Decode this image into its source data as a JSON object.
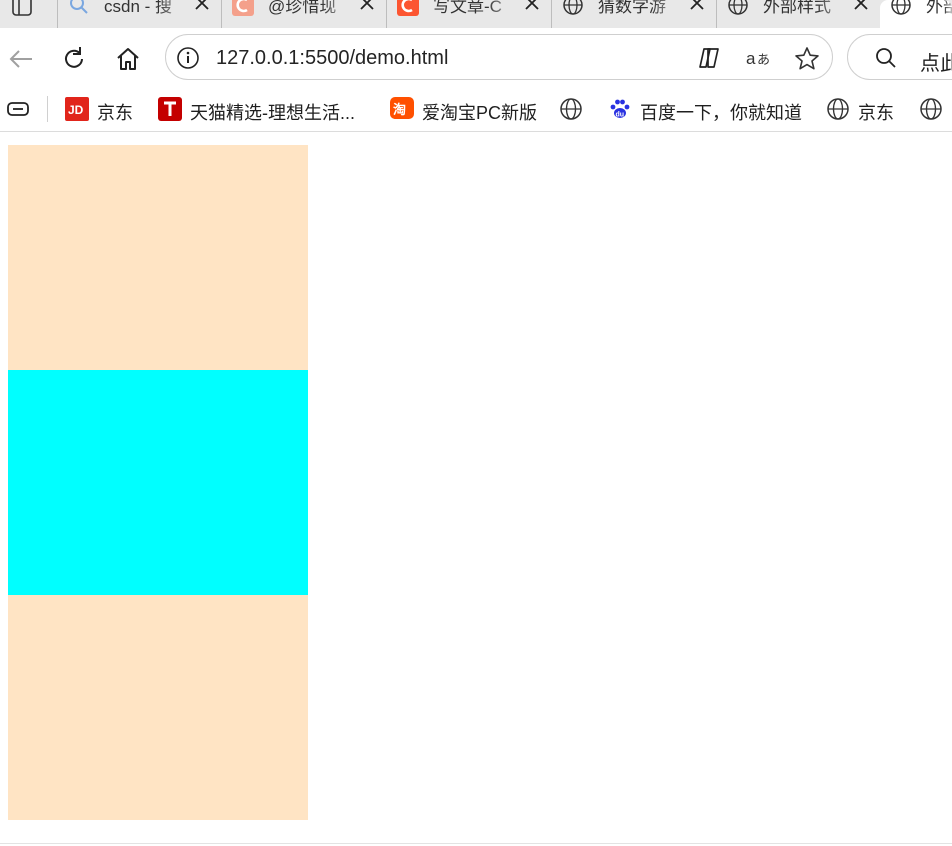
{
  "browser": {
    "tabs": [
      {
        "title": "csdn - 搜",
        "favicon": "search-icon"
      },
      {
        "title": "@珍惜现",
        "favicon": "csdn-c-icon"
      },
      {
        "title": "写文章-C",
        "favicon": "csdn-c-icon"
      },
      {
        "title": "猜数字游",
        "favicon": "globe-icon"
      },
      {
        "title": "外部样式",
        "favicon": "globe-icon"
      },
      {
        "title": "外部",
        "favicon": "globe-icon"
      }
    ],
    "address": {
      "url": "127.0.0.1:5500/demo.html"
    },
    "search": {
      "text": "点此"
    },
    "bookmarks": [
      {
        "label": "京东",
        "icon": "jd-icon",
        "color": "#e1251b"
      },
      {
        "label": "天猫精选-理想生活...",
        "icon": "tmall-icon",
        "color": "#c40000"
      },
      {
        "label": "爱淘宝PC新版",
        "icon": "taobao-icon",
        "color": "#ff5000"
      },
      {
        "label": "",
        "icon": "globe-icon"
      },
      {
        "label": "百度一下，你就知道",
        "icon": "baidu-icon",
        "color": "#2932e1"
      },
      {
        "label": "京东",
        "icon": "globe-icon"
      },
      {
        "label": "",
        "icon": "globe-icon"
      }
    ]
  },
  "page": {
    "blocks": [
      {
        "name": "top",
        "color": "#ffe4c4"
      },
      {
        "name": "middle",
        "color": "#00ffff"
      },
      {
        "name": "bottom",
        "color": "#ffe4c4"
      }
    ]
  }
}
